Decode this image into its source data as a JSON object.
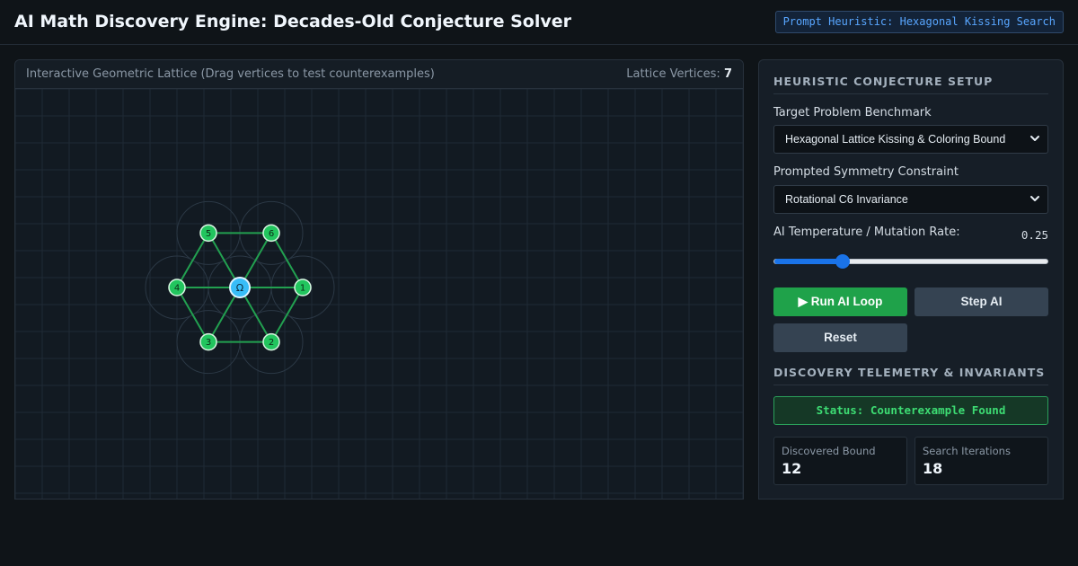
{
  "header": {
    "title": "AI Math Discovery Engine: Decades-Old Conjecture Solver",
    "heuristic_badge": "Prompt Heuristic: Hexagonal Kissing Search"
  },
  "lattice": {
    "caption": "Interactive Geometric Lattice (Drag vertices to test counterexamples)",
    "vertex_count_label": "Lattice Vertices:",
    "vertex_count": "7",
    "center_label": "Ω",
    "vertices": [
      {
        "label": "1"
      },
      {
        "label": "2"
      },
      {
        "label": "3"
      },
      {
        "label": "4"
      },
      {
        "label": "5"
      },
      {
        "label": "6"
      }
    ]
  },
  "setup": {
    "section_title": "HEURISTIC CONJECTURE SETUP",
    "benchmark_label": "Target Problem Benchmark",
    "benchmark_value": "Hexagonal Lattice Kissing & Coloring Bound",
    "symmetry_label": "Prompted Symmetry Constraint",
    "symmetry_value": "Rotational C6 Invariance",
    "temperature_label": "AI Temperature / Mutation Rate:",
    "temperature_value": "0.25",
    "temperature_level": 0.25,
    "run_button": "▶ Run AI Loop",
    "step_button": "Step AI",
    "reset_button": "Reset"
  },
  "telemetry": {
    "section_title": "DISCOVERY TELEMETRY & INVARIANTS",
    "status": "Status: Counterexample Found",
    "discovered_bound_label": "Discovered Bound",
    "discovered_bound_value": "12",
    "iterations_label": "Search Iterations",
    "iterations_value": "18"
  },
  "colors": {
    "accent_blue": "#1a73e8",
    "vertex_green": "#22c55e",
    "center_blue": "#38bdf8",
    "success_green": "#3ddc73"
  }
}
